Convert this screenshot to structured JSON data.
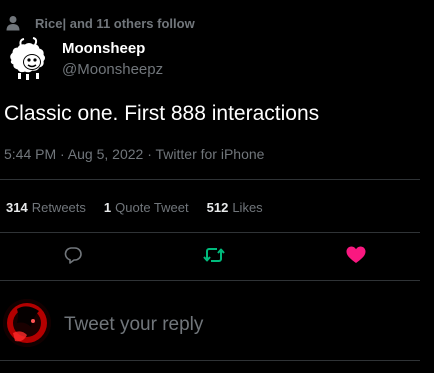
{
  "social_context": {
    "icon": "person-icon",
    "text": "Rice| and 11 others follow"
  },
  "author": {
    "display_name": "Moonsheep",
    "handle": "@Moonsheepz",
    "avatar_icon": "sheep-avatar-icon"
  },
  "tweet": {
    "text": "Classic one. First 888 interactions",
    "meta": "5:44 PM · Aug 5, 2022 · Twitter for iPhone"
  },
  "stats": [
    {
      "count": "314",
      "label": "Retweets"
    },
    {
      "count": "1",
      "label": "Quote Tweet"
    },
    {
      "count": "512",
      "label": "Likes"
    }
  ],
  "actions": {
    "reply_icon": "reply-icon",
    "retweet_icon": "retweet-icon",
    "like_icon": "heart-icon"
  },
  "reply": {
    "placeholder": "Tweet your reply"
  },
  "colors": {
    "background": "#000000",
    "muted": "#71767b",
    "divider": "#2f3336",
    "retweet_active": "#00ba7c",
    "like_active": "#f91880"
  }
}
